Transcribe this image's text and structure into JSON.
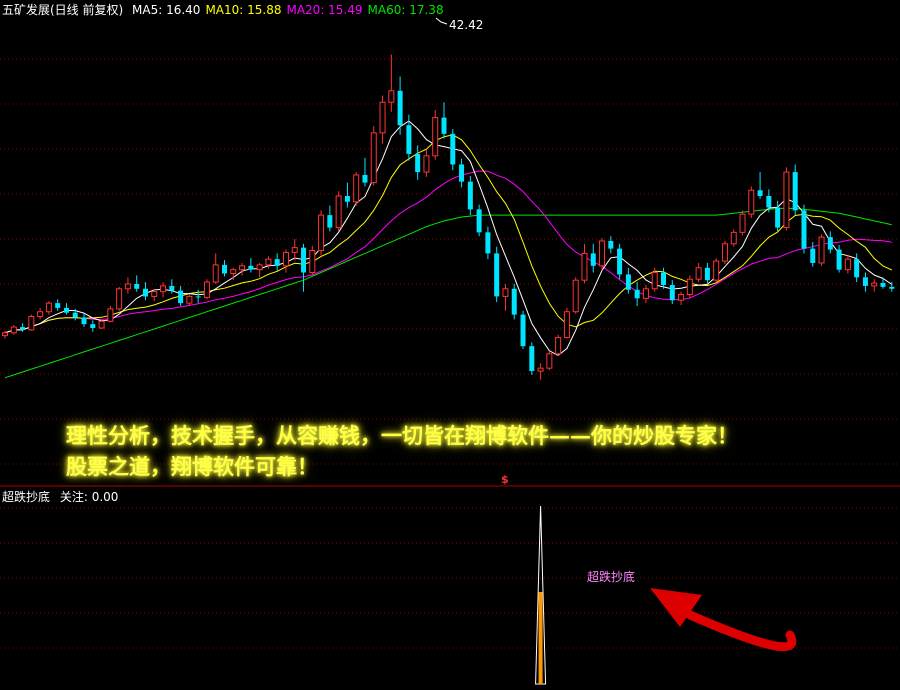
{
  "main_header": {
    "title": "五矿发展(日线 前复权)",
    "indicators": [
      {
        "label": "MA5: 16.40",
        "color": "#ffffff"
      },
      {
        "label": "MA10: 15.88",
        "color": "#ffff00"
      },
      {
        "label": "MA20: 15.49",
        "color": "#ff00ff"
      },
      {
        "label": "MA60: 17.38",
        "color": "#00e600"
      }
    ]
  },
  "peak_label": "42.42",
  "promo_lines": [
    "理性分析，技术握手，从容赚钱，一切皆在翔博软件——你的炒股专家！",
    "股票之道，翔博软件可靠！"
  ],
  "divider_marker": "$",
  "sub_panel": {
    "title": "超跌抄底",
    "value": "关注: 0.00",
    "signal_label": "超跌抄底"
  },
  "colors": {
    "up": "#ff3333",
    "down": "#00e5ff",
    "ma5": "#ffffff",
    "ma10": "#ffff00",
    "ma20": "#ff00ff",
    "ma60": "#00e600",
    "grid": "#880000",
    "signal": "#ff9900",
    "signal_label": "#ff88ff",
    "arrow": "#dd0000"
  },
  "chart_data": {
    "type": "candlestick",
    "series_names": [
      "MA5",
      "MA10",
      "MA20",
      "MA60"
    ],
    "ohlc": [
      [
        13.0,
        13.5,
        12.7,
        13.3
      ],
      [
        13.3,
        14.1,
        13.1,
        13.9
      ],
      [
        13.9,
        14.3,
        13.4,
        13.6
      ],
      [
        13.6,
        15.2,
        13.5,
        15.0
      ],
      [
        15.0,
        15.9,
        14.7,
        15.5
      ],
      [
        15.5,
        16.6,
        15.2,
        16.4
      ],
      [
        16.4,
        16.8,
        15.6,
        15.9
      ],
      [
        15.9,
        16.4,
        15.2,
        15.4
      ],
      [
        15.4,
        15.8,
        14.6,
        14.9
      ],
      [
        14.9,
        15.3,
        13.9,
        14.2
      ],
      [
        14.2,
        14.6,
        13.4,
        13.8
      ],
      [
        13.8,
        14.6,
        13.7,
        14.5
      ],
      [
        14.5,
        16.1,
        14.4,
        15.8
      ],
      [
        15.8,
        18.1,
        15.6,
        17.9
      ],
      [
        17.9,
        19.1,
        17.4,
        18.4
      ],
      [
        18.4,
        19.3,
        17.6,
        17.9
      ],
      [
        17.9,
        18.6,
        16.7,
        17.1
      ],
      [
        17.1,
        17.9,
        16.6,
        17.6
      ],
      [
        17.6,
        18.6,
        17.0,
        18.2
      ],
      [
        18.2,
        18.9,
        17.4,
        17.7
      ],
      [
        17.7,
        18.2,
        16.1,
        16.4
      ],
      [
        16.4,
        17.3,
        16.1,
        17.1
      ],
      [
        17.1,
        17.8,
        16.4,
        17.0
      ],
      [
        17.0,
        18.9,
        16.8,
        18.6
      ],
      [
        18.6,
        21.6,
        18.4,
        20.4
      ],
      [
        20.4,
        20.9,
        19.2,
        19.5
      ],
      [
        19.5,
        20.1,
        18.8,
        19.9
      ],
      [
        19.9,
        20.6,
        19.3,
        20.3
      ],
      [
        20.3,
        21.1,
        19.6,
        19.9
      ],
      [
        19.9,
        20.6,
        19.1,
        20.4
      ],
      [
        20.4,
        21.3,
        20.0,
        21.0
      ],
      [
        21.0,
        21.6,
        19.8,
        20.3
      ],
      [
        20.3,
        22.0,
        19.6,
        21.7
      ],
      [
        21.7,
        23.1,
        20.9,
        22.2
      ],
      [
        22.2,
        22.6,
        17.6,
        19.6
      ],
      [
        19.6,
        22.4,
        19.4,
        21.9
      ],
      [
        21.9,
        26.1,
        21.4,
        25.6
      ],
      [
        25.6,
        26.6,
        23.9,
        24.3
      ],
      [
        24.3,
        28.1,
        23.9,
        27.6
      ],
      [
        27.6,
        29.0,
        26.4,
        27.0
      ],
      [
        27.0,
        30.1,
        26.6,
        29.8
      ],
      [
        29.8,
        31.6,
        28.6,
        29.0
      ],
      [
        29.0,
        34.9,
        28.7,
        34.2
      ],
      [
        34.2,
        38.1,
        33.1,
        37.4
      ],
      [
        37.4,
        42.4,
        36.4,
        38.6
      ],
      [
        38.6,
        40.1,
        34.0,
        35.0
      ],
      [
        35.0,
        36.1,
        31.3,
        32.0
      ],
      [
        32.0,
        32.9,
        29.3,
        30.1
      ],
      [
        30.1,
        32.4,
        29.6,
        31.8
      ],
      [
        31.8,
        36.6,
        31.4,
        35.8
      ],
      [
        35.8,
        37.4,
        33.6,
        34.1
      ],
      [
        34.1,
        34.6,
        30.3,
        30.9
      ],
      [
        30.9,
        31.5,
        28.5,
        29.1
      ],
      [
        29.1,
        29.7,
        25.6,
        26.2
      ],
      [
        26.2,
        26.7,
        23.4,
        23.8
      ],
      [
        23.8,
        24.4,
        21.0,
        21.6
      ],
      [
        21.6,
        22.3,
        16.5,
        17.1
      ],
      [
        17.1,
        18.4,
        15.6,
        17.9
      ],
      [
        17.9,
        18.4,
        14.7,
        15.2
      ],
      [
        15.2,
        15.6,
        11.6,
        11.9
      ],
      [
        11.9,
        12.3,
        8.9,
        9.3
      ],
      [
        9.3,
        10.1,
        8.4,
        9.6
      ],
      [
        9.6,
        11.4,
        9.4,
        11.1
      ],
      [
        11.1,
        13.1,
        10.9,
        12.8
      ],
      [
        12.8,
        15.9,
        12.7,
        15.5
      ],
      [
        15.5,
        19.1,
        15.3,
        18.8
      ],
      [
        18.8,
        22.6,
        18.5,
        21.6
      ],
      [
        21.6,
        22.6,
        19.6,
        20.3
      ],
      [
        20.3,
        23.2,
        19.9,
        22.9
      ],
      [
        22.9,
        23.4,
        21.6,
        22.1
      ],
      [
        22.1,
        22.6,
        18.9,
        19.4
      ],
      [
        19.4,
        20.1,
        17.4,
        17.8
      ],
      [
        17.8,
        18.6,
        16.1,
        16.9
      ],
      [
        16.9,
        18.3,
        16.4,
        17.9
      ],
      [
        17.9,
        20.1,
        17.6,
        19.6
      ],
      [
        19.6,
        20.1,
        17.9,
        18.3
      ],
      [
        18.3,
        18.8,
        16.3,
        16.7
      ],
      [
        16.7,
        17.6,
        16.2,
        17.3
      ],
      [
        17.3,
        19.3,
        17.0,
        18.9
      ],
      [
        18.9,
        20.6,
        18.6,
        20.1
      ],
      [
        20.1,
        20.6,
        18.4,
        18.8
      ],
      [
        18.8,
        21.1,
        18.6,
        20.8
      ],
      [
        20.8,
        22.9,
        20.5,
        22.6
      ],
      [
        22.6,
        24.1,
        22.3,
        23.8
      ],
      [
        23.8,
        26.1,
        23.5,
        25.7
      ],
      [
        25.7,
        28.6,
        25.3,
        28.2
      ],
      [
        28.2,
        30.1,
        27.3,
        27.6
      ],
      [
        27.6,
        28.3,
        25.9,
        26.4
      ],
      [
        26.4,
        27.1,
        23.9,
        24.3
      ],
      [
        24.3,
        30.6,
        24.0,
        30.1
      ],
      [
        30.1,
        30.9,
        25.6,
        26.1
      ],
      [
        26.1,
        26.7,
        21.6,
        22.1
      ],
      [
        22.1,
        22.8,
        20.2,
        20.6
      ],
      [
        20.6,
        23.6,
        20.3,
        23.3
      ],
      [
        23.3,
        23.9,
        21.6,
        22.0
      ],
      [
        22.0,
        22.5,
        19.6,
        19.9
      ],
      [
        19.9,
        21.4,
        19.5,
        21.0
      ],
      [
        21.0,
        21.6,
        18.6,
        19.1
      ],
      [
        19.1,
        19.6,
        17.6,
        18.2
      ],
      [
        18.2,
        18.9,
        17.6,
        18.5
      ],
      [
        18.5,
        19.1,
        17.9,
        18.1
      ],
      [
        18.1,
        18.6,
        17.6,
        17.9
      ]
    ],
    "ma60": [
      8.6,
      8.9,
      9.2,
      9.5,
      9.8,
      10.1,
      10.4,
      10.7,
      11.0,
      11.3,
      11.6,
      11.9,
      12.2,
      12.5,
      12.8,
      13.1,
      13.4,
      13.7,
      14.0,
      14.3,
      14.6,
      14.9,
      15.2,
      15.5,
      15.8,
      16.1,
      16.4,
      16.7,
      17.0,
      17.3,
      17.6,
      17.9,
      18.2,
      18.5,
      18.8,
      19.2,
      19.6,
      20.0,
      20.4,
      20.8,
      21.2,
      21.6,
      22.0,
      22.4,
      22.8,
      23.2,
      23.6,
      24.0,
      24.4,
      24.7,
      25.0,
      25.2,
      25.4,
      25.5,
      25.6,
      25.6,
      25.6,
      25.6,
      25.6,
      25.6,
      25.6,
      25.6,
      25.6,
      25.6,
      25.6,
      25.6,
      25.6,
      25.6,
      25.6,
      25.6,
      25.6,
      25.6,
      25.6,
      25.6,
      25.6,
      25.6,
      25.6,
      25.6,
      25.6,
      25.6,
      25.6,
      25.6,
      25.7,
      25.8,
      25.9,
      26.0,
      26.1,
      26.2,
      26.3,
      26.3,
      26.3,
      26.2,
      26.1,
      26.0,
      25.9,
      25.8,
      25.6,
      25.4,
      25.2,
      25.0,
      24.8,
      24.6
    ],
    "ma_tail_values": {
      "MA5": 16.4,
      "MA10": 15.88,
      "MA20": 15.49,
      "MA60": 17.38
    },
    "y_range": [
      0,
      46
    ],
    "peak": {
      "index": 44,
      "value": 42.42
    },
    "indicator": {
      "name": "超跌抄底",
      "value": 0.0,
      "signal_index": 61,
      "signal_value": 1.0
    }
  }
}
